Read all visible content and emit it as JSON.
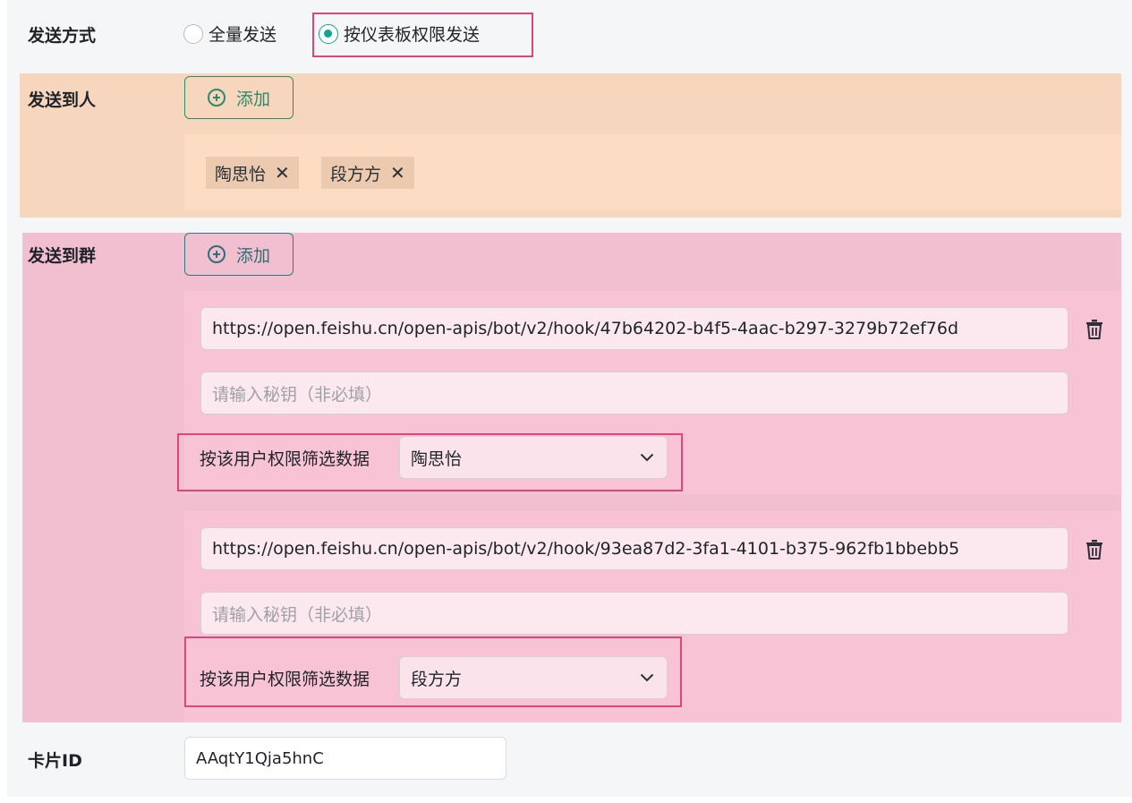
{
  "send_mode": {
    "label": "发送方式",
    "options": [
      {
        "label": "全量发送",
        "selected": false
      },
      {
        "label": "按仪表板权限发送",
        "selected": true
      }
    ]
  },
  "send_to_person": {
    "label": "发送到人",
    "add_label": "添加",
    "tags": [
      "陶思怡",
      "段方方"
    ]
  },
  "send_to_group": {
    "label": "发送到群",
    "add_label": "添加",
    "groups": [
      {
        "webhook": "https://open.feishu.cn/open-apis/bot/v2/hook/47b64202-b4f5-4aac-b297-3279b72ef76d",
        "secret_placeholder": "请输入秘钥（非必填）",
        "filter_label": "按该用户权限筛选数据",
        "filter_user": "陶思怡"
      },
      {
        "webhook": "https://open.feishu.cn/open-apis/bot/v2/hook/93ea87d2-3fa1-4101-b375-962fb1bbebb5",
        "secret_placeholder": "请输入秘钥（非必填）",
        "filter_label": "按该用户权限筛选数据",
        "filter_user": "段方方"
      }
    ]
  },
  "card": {
    "label": "卡片ID",
    "value": "AAqtY1Qja5hnC"
  },
  "colors": {
    "accent": "#14a38b",
    "highlight_border": "#e0447a",
    "person_section_bg": "#fcdcc2",
    "group_section_bg": "#f8c3d4"
  }
}
